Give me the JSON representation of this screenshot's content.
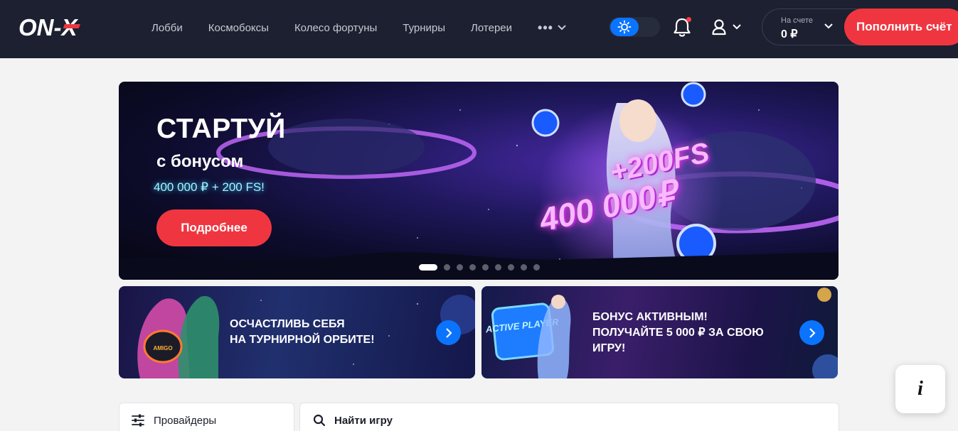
{
  "brand": {
    "logo_text": "ON-X"
  },
  "nav": {
    "items": [
      {
        "label": "Лобби"
      },
      {
        "label": "Космобоксы"
      },
      {
        "label": "Колесо фортуны"
      },
      {
        "label": "Турниры"
      },
      {
        "label": "Лотереи"
      }
    ],
    "more_label": "•••"
  },
  "header": {
    "theme_icon": "sun-icon",
    "notifications_icon": "bell-icon",
    "notifications_unread": true,
    "user_icon": "user-icon",
    "balance": {
      "label": "На счете",
      "value": "0 ₽"
    },
    "deposit_label": "Пополнить счёт"
  },
  "hero": {
    "title": "СТАРТУЙ",
    "subtitle": "с бонусом",
    "offer": "400 000 ₽ + 200 FS!",
    "cta_label": "Подробнее",
    "promo_fs": "+200FS",
    "promo_amount": "400 000₽",
    "slides_total": 9,
    "active_slide": 1
  },
  "promos": [
    {
      "text": "ОСЧАСТЛИВЬ СЕБЯ\nНА ТУРНИРНОЙ ОРБИТЕ!",
      "art_label": "AMIGO"
    },
    {
      "text": "БОНУС АКТИВНЫМ!\nПОЛУЧАЙТЕ 5 000 ₽ ЗА СВОЮ\nИГРУ!",
      "art_label": "ACTIVE PLAYER"
    }
  ],
  "filters": {
    "providers_label": "Провайдеры",
    "search_placeholder": "Найти игру"
  },
  "info_button": {
    "label": "i"
  },
  "colors": {
    "header_bg": "#1c2030",
    "accent_red": "#ef3640",
    "accent_blue": "#0a74ff",
    "page_bg": "#f3f3f4"
  }
}
